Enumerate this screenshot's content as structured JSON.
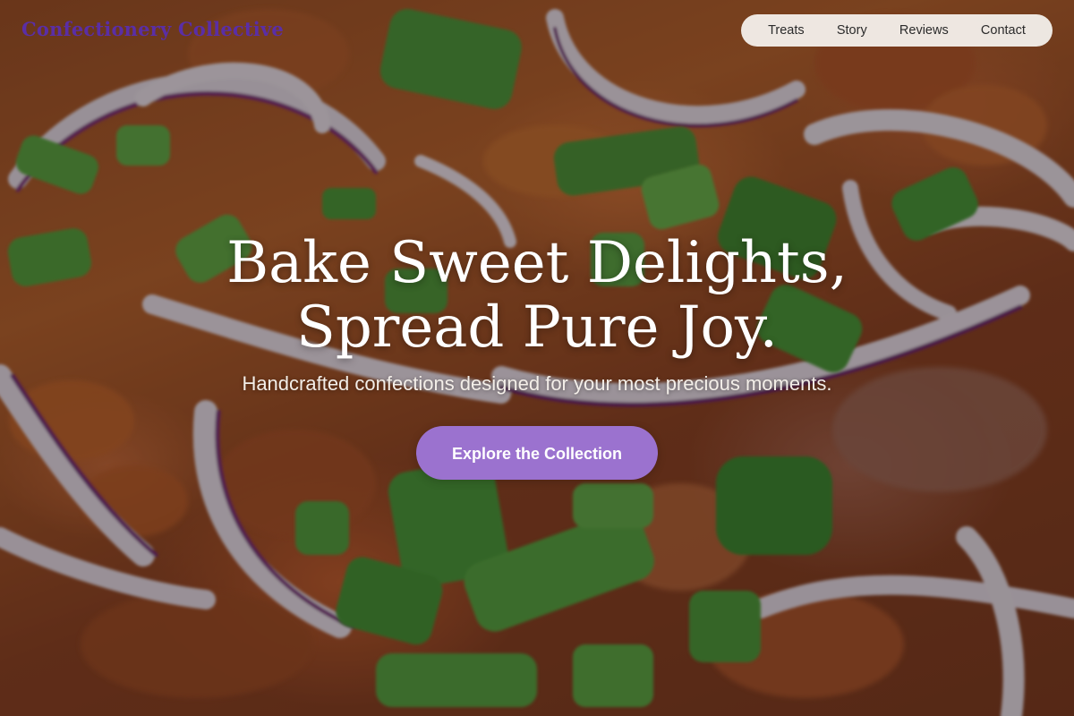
{
  "brand": {
    "name": "Confectionery Collective",
    "color": "#5a2ea6"
  },
  "nav": {
    "items": [
      {
        "label": "Treats"
      },
      {
        "label": "Story"
      },
      {
        "label": "Reviews"
      },
      {
        "label": "Contact"
      }
    ]
  },
  "hero": {
    "headline_line1": "Bake Sweet Delights,",
    "headline_line2": "Spread Pure Joy.",
    "subtitle": "Handcrafted confections designed for your most precious moments.",
    "cta_label": "Explore the Collection",
    "cta_color": "#9b72cf"
  }
}
